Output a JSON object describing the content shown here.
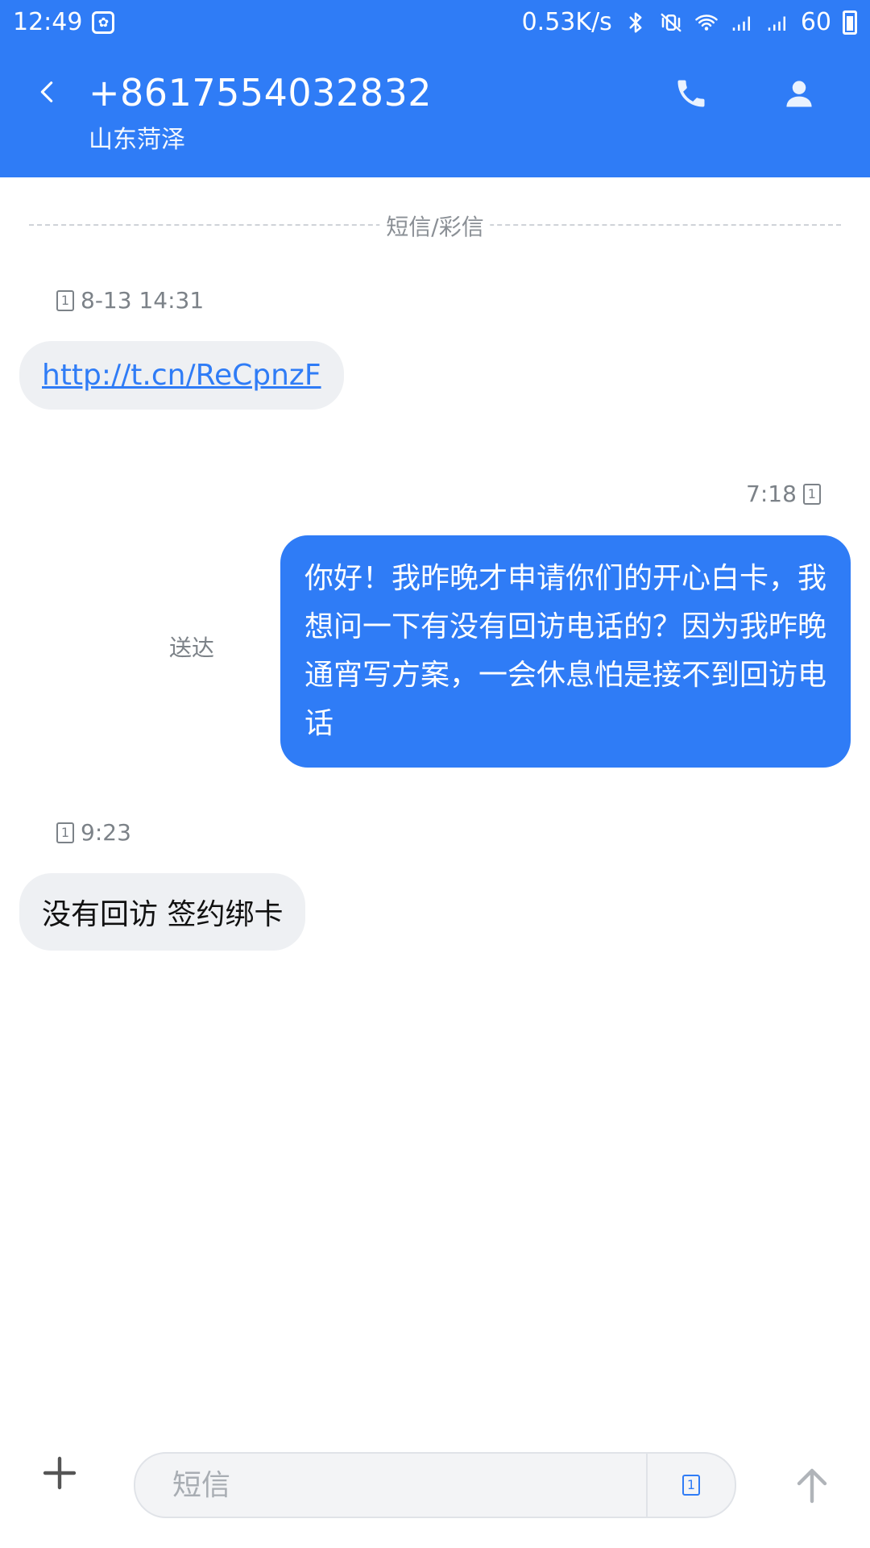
{
  "status_bar": {
    "time": "12:49",
    "network_speed": "0.53K/s",
    "battery": "60",
    "icons": [
      "app-badge-icon",
      "bluetooth-icon",
      "vibrate-icon",
      "wifi-icon",
      "signal-icon",
      "signal-icon-2",
      "battery-icon"
    ]
  },
  "header": {
    "title": "+8617554032832",
    "subtitle": "山东菏泽",
    "icons": [
      "back-icon",
      "phone-icon",
      "contact-icon"
    ]
  },
  "conversation": {
    "divider_label": "短信/彩信",
    "messages": [
      {
        "direction": "in",
        "timestamp": "8-13 14:31",
        "sim": "1",
        "text": "http://t.cn/ReCpnzF"
      },
      {
        "direction": "out",
        "timestamp": "7:18",
        "sim": "1",
        "text": "你好！我昨晚才申请你们的开心白卡，我想问一下有没有回访电话的？因为我昨晚通宵写方案，一会休息怕是接不到回访电话",
        "status": "送达"
      },
      {
        "direction": "in",
        "timestamp": "9:23",
        "sim": "1",
        "text": "没有回访 签约绑卡"
      }
    ]
  },
  "composer": {
    "placeholder": "短信",
    "sim": "1",
    "icons": [
      "plus-icon",
      "sim-icon",
      "send-icon"
    ]
  },
  "colors": {
    "accent": "#2f7cf6",
    "incoming_bubble": "#eef0f3",
    "meta_text": "#7c8288"
  }
}
